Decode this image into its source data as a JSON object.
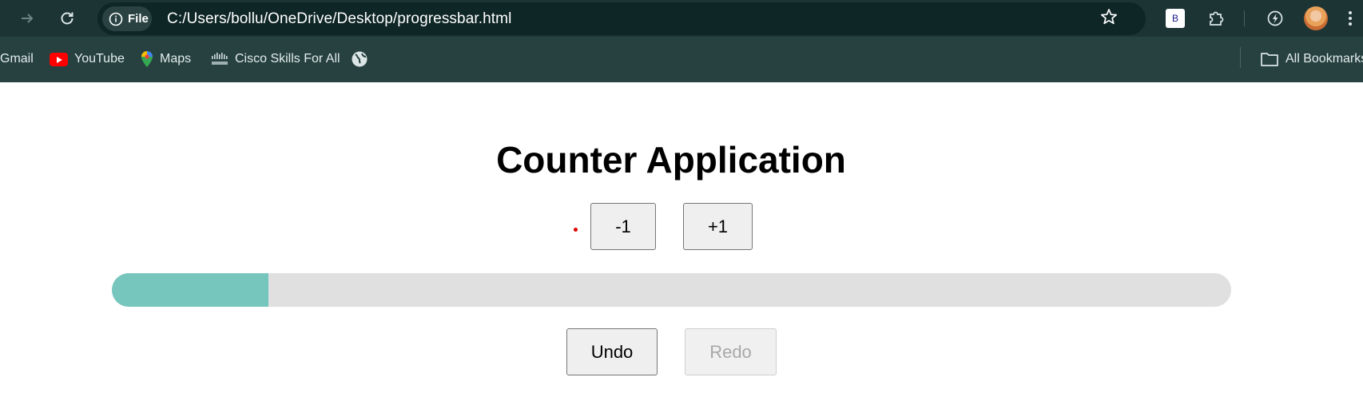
{
  "browser": {
    "url": "C:/Users/bollu/OneDrive/Desktop/progressbar.html",
    "file_chip_label": "File",
    "extension_b_label": "B",
    "icons": [
      "forward-arrow-icon",
      "reload-icon",
      "info-icon",
      "star-icon",
      "extension-b-icon",
      "puzzle-icon",
      "performance-icon",
      "avatar",
      "kebab-menu-icon"
    ]
  },
  "bookmarks": {
    "items": [
      {
        "label": "Gmail"
      },
      {
        "label": "YouTube",
        "icon": "youtube-icon"
      },
      {
        "label": "Maps",
        "icon": "maps-pin-icon"
      },
      {
        "label": "Cisco Skills For All",
        "icon": "cisco-icon"
      },
      {
        "label": "",
        "icon": "globe-icon"
      }
    ],
    "all_bookmarks_label": "All Bookmarks"
  },
  "app": {
    "title": "Counter Application",
    "decrement_label": "-1",
    "increment_label": "+1",
    "undo_label": "Undo",
    "redo_label": "Redo",
    "redo_disabled": true,
    "progress_percent": 14,
    "colors": {
      "progress_fill": "#76c6be",
      "progress_track": "#e0e0e0",
      "chrome_bg": "#1c3434",
      "bookmarks_bg": "#274141",
      "counter_dot": "#e00000"
    }
  }
}
